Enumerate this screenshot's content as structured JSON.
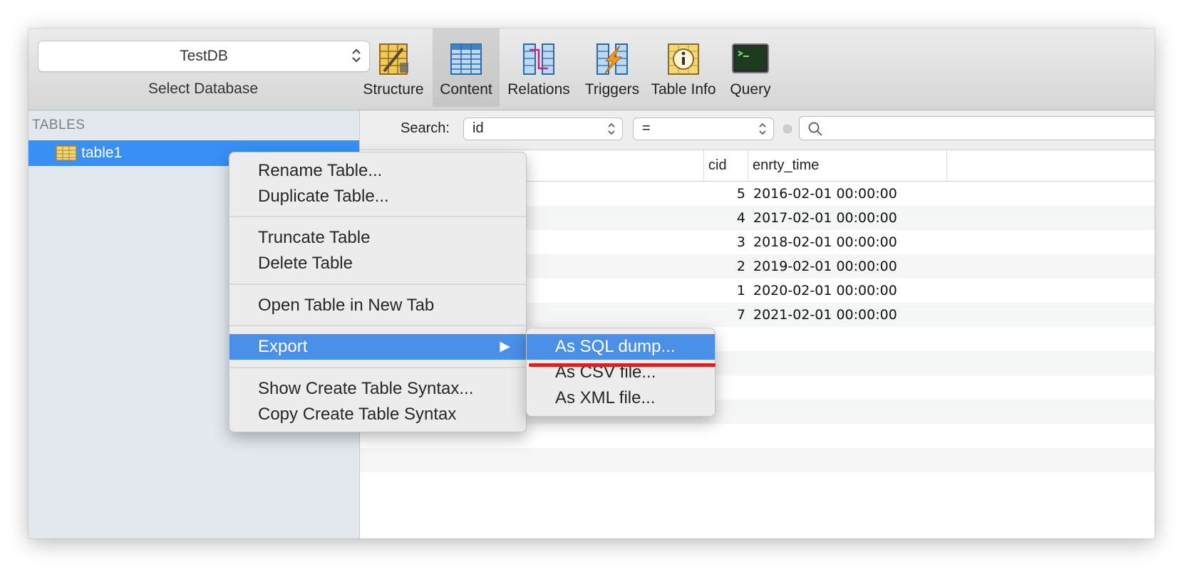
{
  "toolbar": {
    "database": "TestDB",
    "select_label": "Select Database",
    "buttons": [
      {
        "label": "Structure",
        "icon": "structure-icon"
      },
      {
        "label": "Content",
        "icon": "content-icon",
        "active": true
      },
      {
        "label": "Relations",
        "icon": "relations-icon"
      },
      {
        "label": "Triggers",
        "icon": "triggers-icon"
      },
      {
        "label": "Table Info",
        "icon": "table-info-icon"
      },
      {
        "label": "Query",
        "icon": "query-icon"
      }
    ]
  },
  "sidebar": {
    "heading": "TABLES",
    "tables": [
      {
        "name": "table1",
        "selected": true
      }
    ]
  },
  "search": {
    "label": "Search:",
    "field": "id",
    "operator": "="
  },
  "grid": {
    "columns": [
      "cid",
      "enrty_time"
    ],
    "rows": [
      {
        "cid": "5",
        "time": "2016-02-01 00:00:00"
      },
      {
        "cid": "4",
        "time": "2017-02-01 00:00:00"
      },
      {
        "cid": "3",
        "time": "2018-02-01 00:00:00"
      },
      {
        "cid": "2",
        "time": "2019-02-01 00:00:00"
      },
      {
        "cid": "1",
        "time": "2020-02-01 00:00:00"
      },
      {
        "cid": "7",
        "time": "2021-02-01 00:00:00"
      }
    ]
  },
  "context_menu": {
    "items": [
      "Rename Table...",
      "Duplicate Table...",
      "Truncate Table",
      "Delete Table",
      "Open Table in New Tab",
      "Export",
      "Show Create Table Syntax...",
      "Copy Create Table Syntax"
    ],
    "highlighted": "Export",
    "submenu_arrow": "▶"
  },
  "export_submenu": {
    "items": [
      "As SQL dump...",
      "As CSV file...",
      "As XML file..."
    ],
    "highlighted": "As SQL dump..."
  },
  "colors": {
    "selection": "#3a8ff5",
    "menu_highlight": "#4a90e8",
    "annotation_line": "#e01e1e"
  }
}
